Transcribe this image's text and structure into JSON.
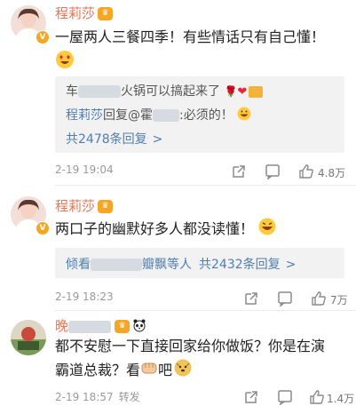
{
  "comments": [
    {
      "name": "程莉莎",
      "text": "一屋两人三餐四季！有些情话只有自己懂！",
      "replies": {
        "r1_prefix": "车",
        "r1_suffix": "火锅可以搞起来了",
        "r2_name": "程莉莎",
        "r2_mid": "回复@霍",
        "r2_suffix": ":必须的！",
        "more": "共2478条回复",
        "more_arrow": ">"
      },
      "time": "2-19 19:04",
      "likes": "4.8万"
    },
    {
      "name": "程莉莎",
      "text": "两口子的幽默好多人都没读懂！",
      "replies": {
        "prefix": "倾看",
        "mid": "瓣飘等人",
        "more": "共2432条回复",
        "more_arrow": ">"
      },
      "time": "2-19 18:23",
      "likes": "7万"
    },
    {
      "name_visible": "晚",
      "text_line1": "都不安慰一下直接回家给你做饭？你是在演",
      "text_line2_a": "霸道总裁？看",
      "text_line2_b": "吧",
      "time": "2-19 18:57",
      "repost": "转发",
      "likes": "1.4万"
    }
  ],
  "icons": {
    "vip_badge": "V",
    "verified_badge": "V"
  },
  "colors": {
    "name": "#eb7350",
    "link": "#507daf",
    "reply_bg": "#f2f2f2",
    "meta": "#999999"
  }
}
